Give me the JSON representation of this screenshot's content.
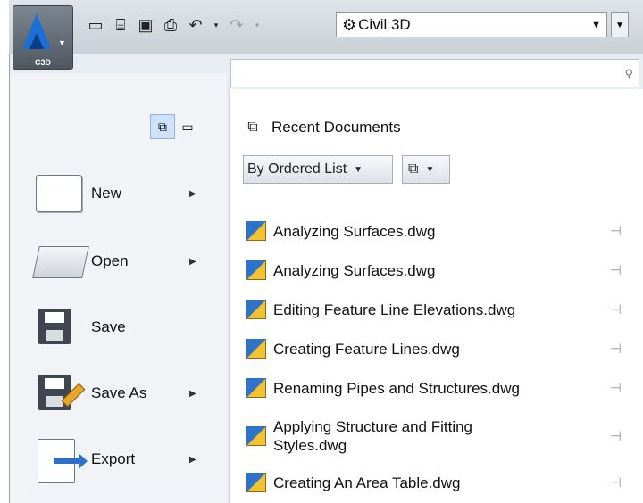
{
  "app": {
    "logo_text": "C3D",
    "workspace": "Civil 3D"
  },
  "quick_access": [
    {
      "name": "new-icon",
      "glyph": "🗋"
    },
    {
      "name": "open-icon",
      "glyph": "🗁"
    },
    {
      "name": "save-icon",
      "glyph": "💾"
    },
    {
      "name": "print-icon",
      "glyph": "🖶"
    },
    {
      "name": "undo-icon",
      "glyph": "↶"
    },
    {
      "name": "redo-icon",
      "glyph": "↷"
    }
  ],
  "search": {
    "placeholder": ""
  },
  "menu": [
    {
      "label": "New",
      "has_submenu": true
    },
    {
      "label": "Open",
      "has_submenu": true
    },
    {
      "label": "Save",
      "has_submenu": false
    },
    {
      "label": "Save As",
      "has_submenu": true
    },
    {
      "label": "Export",
      "has_submenu": true
    }
  ],
  "recent": {
    "title": "Recent Documents",
    "sort": "By Ordered List",
    "documents": [
      "Analyzing Surfaces.dwg",
      "Analyzing Surfaces.dwg",
      "Editing Feature Line Elevations.dwg",
      "Creating Feature Lines.dwg",
      "Renaming Pipes and Structures.dwg",
      "Applying Structure and Fitting Styles.dwg",
      "Creating An Area Table.dwg"
    ]
  }
}
